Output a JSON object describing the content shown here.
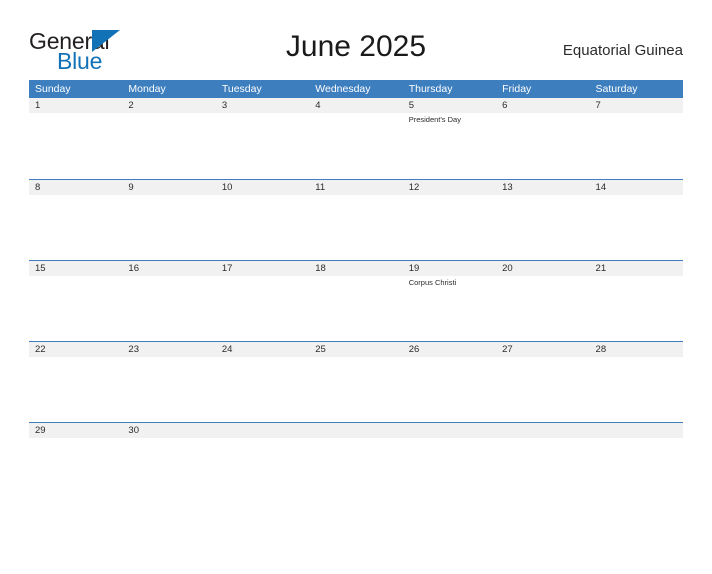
{
  "branding": {
    "logo_text_primary": "General",
    "logo_text_secondary": "Blue",
    "logo_flag_icon": "blue-flag-triangle-icon",
    "brand_blue": "#1272b8"
  },
  "header": {
    "title": "June 2025",
    "region": "Equatorial Guinea"
  },
  "theme": {
    "header_bar_color": "#3d7ebf",
    "day_band_color": "#f1f1f1",
    "row_divider_color": "#3d7ebf",
    "text_color": "#2b2b2b",
    "page_background": "#ffffff"
  },
  "calendar": {
    "weekdays": [
      "Sunday",
      "Monday",
      "Tuesday",
      "Wednesday",
      "Thursday",
      "Friday",
      "Saturday"
    ],
    "weeks": [
      {
        "days": [
          {
            "number": "1",
            "events": []
          },
          {
            "number": "2",
            "events": []
          },
          {
            "number": "3",
            "events": []
          },
          {
            "number": "4",
            "events": []
          },
          {
            "number": "5",
            "events": [
              "President's Day"
            ]
          },
          {
            "number": "6",
            "events": []
          },
          {
            "number": "7",
            "events": []
          }
        ]
      },
      {
        "days": [
          {
            "number": "8",
            "events": []
          },
          {
            "number": "9",
            "events": []
          },
          {
            "number": "10",
            "events": []
          },
          {
            "number": "11",
            "events": []
          },
          {
            "number": "12",
            "events": []
          },
          {
            "number": "13",
            "events": []
          },
          {
            "number": "14",
            "events": []
          }
        ]
      },
      {
        "days": [
          {
            "number": "15",
            "events": []
          },
          {
            "number": "16",
            "events": []
          },
          {
            "number": "17",
            "events": []
          },
          {
            "number": "18",
            "events": []
          },
          {
            "number": "19",
            "events": [
              "Corpus Christi"
            ]
          },
          {
            "number": "20",
            "events": []
          },
          {
            "number": "21",
            "events": []
          }
        ]
      },
      {
        "days": [
          {
            "number": "22",
            "events": []
          },
          {
            "number": "23",
            "events": []
          },
          {
            "number": "24",
            "events": []
          },
          {
            "number": "25",
            "events": []
          },
          {
            "number": "26",
            "events": []
          },
          {
            "number": "27",
            "events": []
          },
          {
            "number": "28",
            "events": []
          }
        ]
      },
      {
        "days": [
          {
            "number": "29",
            "events": []
          },
          {
            "number": "30",
            "events": []
          },
          {
            "number": "",
            "events": []
          },
          {
            "number": "",
            "events": []
          },
          {
            "number": "",
            "events": []
          },
          {
            "number": "",
            "events": []
          },
          {
            "number": "",
            "events": []
          }
        ]
      }
    ]
  }
}
